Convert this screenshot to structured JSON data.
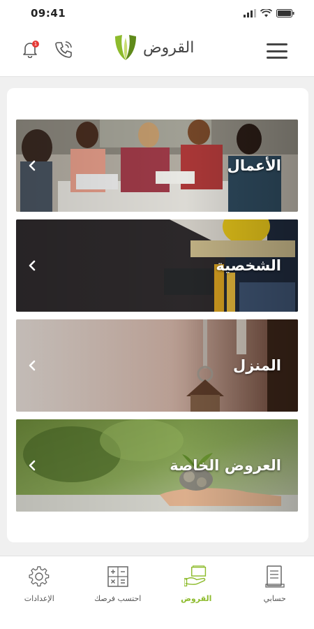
{
  "status_bar": {
    "time": "09:41"
  },
  "header": {
    "title": "القروض",
    "notification_count": "1",
    "brand_color": "#8dbb2c"
  },
  "categories": [
    {
      "label": "الأعمال",
      "icon": "chevron-left-icon"
    },
    {
      "label": "الشخصية",
      "icon": "chevron-left-icon"
    },
    {
      "label": "المنزل",
      "icon": "chevron-left-icon"
    },
    {
      "label": "العروض الخاصة",
      "icon": "chevron-left-icon"
    }
  ],
  "bottom_nav": {
    "active_color": "#8dbb2c",
    "items": [
      {
        "label": "حسابي",
        "icon": "document-icon",
        "active": false
      },
      {
        "label": "القروض",
        "icon": "loan-hand-icon",
        "active": true
      },
      {
        "label": "احتسب فرصك",
        "icon": "calculator-icon",
        "active": false
      },
      {
        "label": "الإعدادات",
        "icon": "gear-icon",
        "active": false
      }
    ]
  }
}
